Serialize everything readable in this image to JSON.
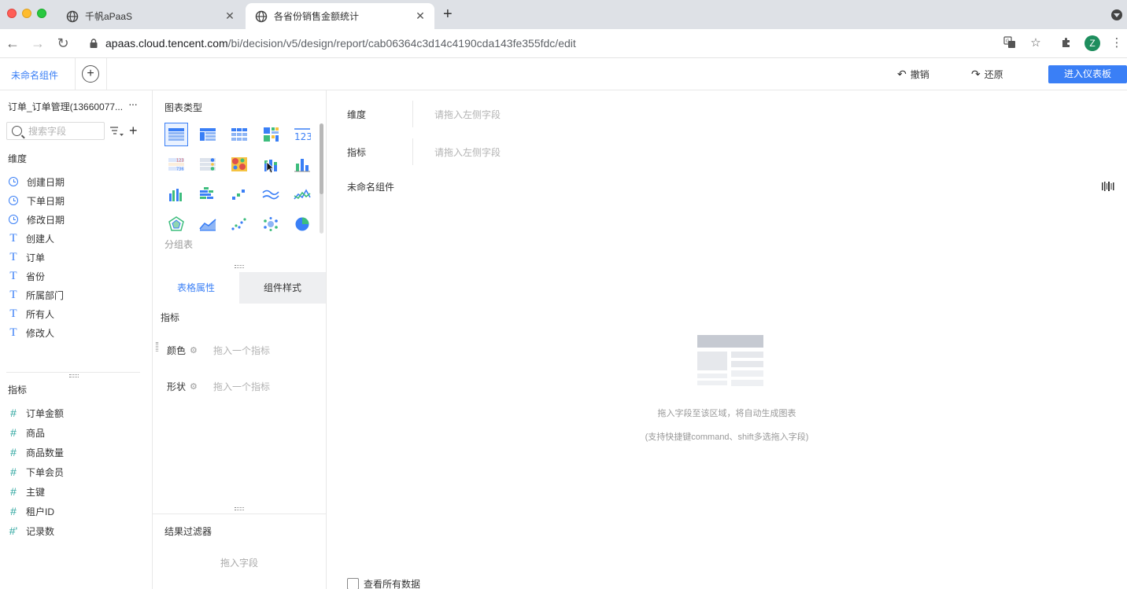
{
  "browser": {
    "tabs": [
      {
        "title": "千帆aPaaS"
      },
      {
        "title": "各省份销售金额统计"
      }
    ],
    "new_tab": "+",
    "url_host": "apaas.cloud.tencent.com",
    "url_path": "/bi/decision/v5/design/report/cab06364c3d14c4190cda143fe355fdc/edit",
    "profile_initial": "Z"
  },
  "toolbar": {
    "component_name": "未命名组件",
    "undo_label": "撤销",
    "redo_label": "还原",
    "enter_dashboard_label": "进入仪表板"
  },
  "left": {
    "dataset_title": "订单_订单管理(13660077...",
    "more": "···",
    "search_placeholder": "搜索字段",
    "dimension_title": "维度",
    "dimensions": [
      {
        "label": "创建日期",
        "type": "date"
      },
      {
        "label": "下单日期",
        "type": "date"
      },
      {
        "label": "修改日期",
        "type": "date"
      },
      {
        "label": "创建人",
        "type": "text"
      },
      {
        "label": "订单",
        "type": "text"
      },
      {
        "label": "省份",
        "type": "text"
      },
      {
        "label": "所属部门",
        "type": "text"
      },
      {
        "label": "所有人",
        "type": "text"
      },
      {
        "label": "修改人",
        "type": "text"
      }
    ],
    "measure_title": "指标",
    "measures": [
      {
        "label": "订单金额"
      },
      {
        "label": "商品"
      },
      {
        "label": "商品数量"
      },
      {
        "label": "下单会员"
      },
      {
        "label": "主键"
      },
      {
        "label": "租户ID"
      },
      {
        "label": "记录数"
      }
    ]
  },
  "middle": {
    "chart_type_title": "图表类型",
    "selected_chart_caption": "分组表",
    "tabs": [
      {
        "label": "表格属性"
      },
      {
        "label": "组件样式"
      }
    ],
    "props_title": "指标",
    "props": [
      {
        "label": "颜色",
        "placeholder": "拖入一个指标"
      },
      {
        "label": "形状",
        "placeholder": "拖入一个指标"
      }
    ],
    "filter_title": "结果过滤器",
    "filter_placeholder": "拖入字段"
  },
  "canvas": {
    "dimension_label": "维度",
    "dimension_placeholder": "请拖入左侧字段",
    "measure_label": "指标",
    "measure_placeholder": "请拖入左侧字段",
    "widget_title": "未命名组件",
    "empty_hint": "拖入字段至该区域，将自动生成图表",
    "empty_subhint": "(支持快捷键command、shift多选拖入字段)",
    "view_all_label": "查看所有数据"
  },
  "colors": {
    "accent": "#3a7ff6",
    "measure_icon": "#2fa6a0"
  }
}
